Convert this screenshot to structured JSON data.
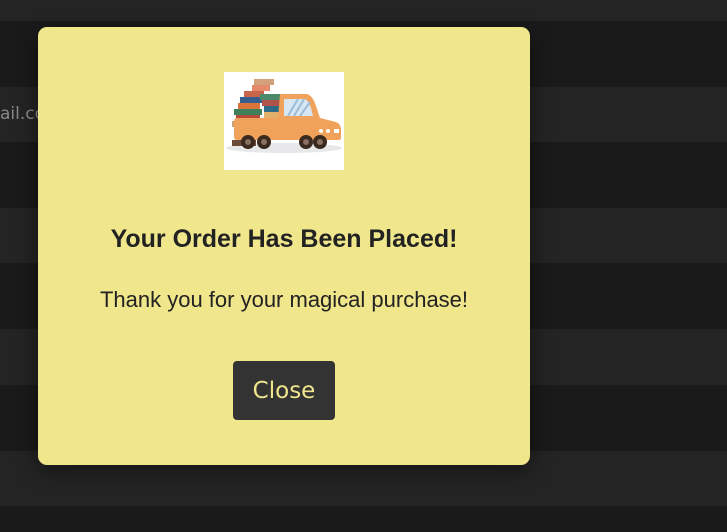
{
  "background": {
    "partial_text": "ail.co"
  },
  "modal": {
    "image_icon": "truck-with-books-icon",
    "title": "Your Order Has Been Placed!",
    "message": "Thank you for your magical purchase!",
    "close_label": "Close"
  },
  "colors": {
    "modal_background": "#f0e68c",
    "button_background": "#333333",
    "button_text": "#f0e68c",
    "page_background": "#1b1b1b"
  }
}
